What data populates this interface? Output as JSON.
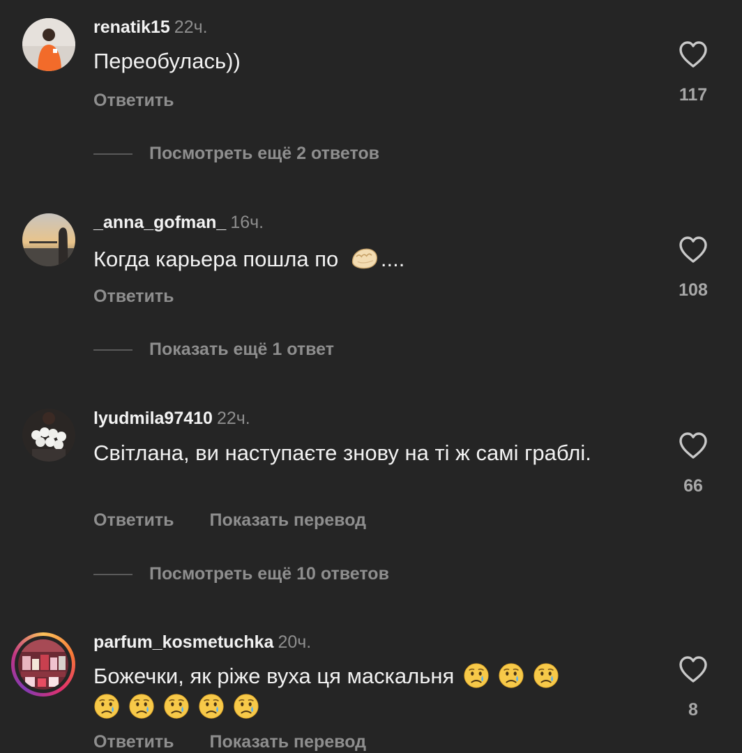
{
  "comments": [
    {
      "username": "renatik15",
      "time": "22ч.",
      "text": "Переобулась))",
      "reply_label": "Ответить",
      "likes": "117",
      "more_replies": "Посмотреть ещё 2 ответов"
    },
    {
      "username": "_anna_gofman_",
      "time": "16ч.",
      "text_before": "Когда карьера пошла по",
      "text_after": "....",
      "emoji": "dumpling",
      "reply_label": "Ответить",
      "likes": "108",
      "more_replies": "Показать ещё 1 ответ"
    },
    {
      "username": "lyudmila97410",
      "time": "22ч.",
      "text": "Світлана, ви наступаєте знову на ті ж самі граблі.",
      "reply_label": "Ответить",
      "translate_label": "Показать перевод",
      "likes": "66",
      "more_replies": "Посмотреть ещё 10 ответов"
    },
    {
      "username": "parfum_kosmetuchka",
      "time": "20ч.",
      "text": "Божечки, як ріже вуха ця маскальня",
      "emoji": "crying-face",
      "emoji_count": 8,
      "reply_label": "Ответить",
      "translate_label": "Показать перевод",
      "likes": "8"
    }
  ],
  "icons": {
    "like": "heart-outline-icon"
  },
  "colors": {
    "background": "#252525",
    "primary_text": "#f2f2f2",
    "secondary_text": "#8e8e8e",
    "story_ring": "#e1306c"
  }
}
